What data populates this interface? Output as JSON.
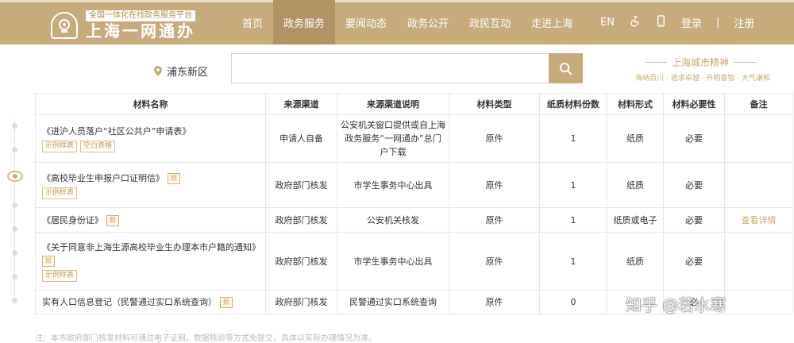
{
  "header": {
    "site_subtitle": "全国一体化在线政务服务平台",
    "site_title": "上海一网通办",
    "nav": [
      "首页",
      "政务服务",
      "要闻动态",
      "政务公开",
      "政民互动",
      "走进上海"
    ],
    "active_nav": "政务服务",
    "lang": "EN",
    "login": "登录",
    "separator": "|",
    "register": "注册",
    "brand_color": "#c7ab7a"
  },
  "search": {
    "location": "浦东新区",
    "placeholder": "",
    "slogan_title": "上海城市精神",
    "slogan_sub": "海纳百川 · 追求卓越 · 开明睿智 · 大气谦和"
  },
  "table": {
    "headers": [
      "材料名称",
      "来源渠道",
      "来源渠道说明",
      "材料类型",
      "纸质材料份数",
      "材料形式",
      "材料必要性",
      "备注"
    ],
    "rows": [
      {
        "name": "《进沪人员落户“社区公共户”申请表》",
        "tags": [
          "示例样表",
          "空白表格"
        ],
        "has_license_icon": false,
        "source": "申请人自备",
        "source_desc": "公安机关窗口提供或自上海政务服务“一网通办”总门户下载",
        "type": "原件",
        "copies": "1",
        "form": "纸质",
        "required": "必要",
        "note": ""
      },
      {
        "name": "《高校毕业生申报户口证明信》",
        "tags": [
          "示例样表"
        ],
        "has_license_icon": true,
        "source": "政府部门核发",
        "source_desc": "市学生事务中心出具",
        "type": "原件",
        "copies": "1",
        "form": "纸质",
        "required": "必要",
        "note": ""
      },
      {
        "name": "《居民身份证》",
        "tags": [],
        "has_license_icon": true,
        "source": "政府部门核发",
        "source_desc": "公安机关核发",
        "type": "原件",
        "copies": "1",
        "form": "纸质或电子",
        "required": "必要",
        "note": "查看详情"
      },
      {
        "name": "《关于同意非上海生源高校毕业生办理本市户籍的通知》",
        "tags": [
          "示例样表"
        ],
        "has_license_icon": true,
        "source": "政府部门核发",
        "source_desc": "市学生事务中心出具",
        "type": "原件",
        "copies": "1",
        "form": "纸质",
        "required": "必要",
        "note": ""
      },
      {
        "name": "实有人口信息登记（民警通过实口系统查询）",
        "tags": [],
        "has_license_icon": true,
        "source": "政府部门核发",
        "source_desc": "民警通过实口系统查询",
        "type": "原件",
        "copies": "0",
        "form": "",
        "required": "必",
        "note": ""
      }
    ],
    "license_icon_label": "照"
  },
  "footnote": "注：本市政府部门核发材料可通过电子证照、数据核验等方式免提交，具体以实际办理情况为准。",
  "watermark": "知乎 @若水寒"
}
